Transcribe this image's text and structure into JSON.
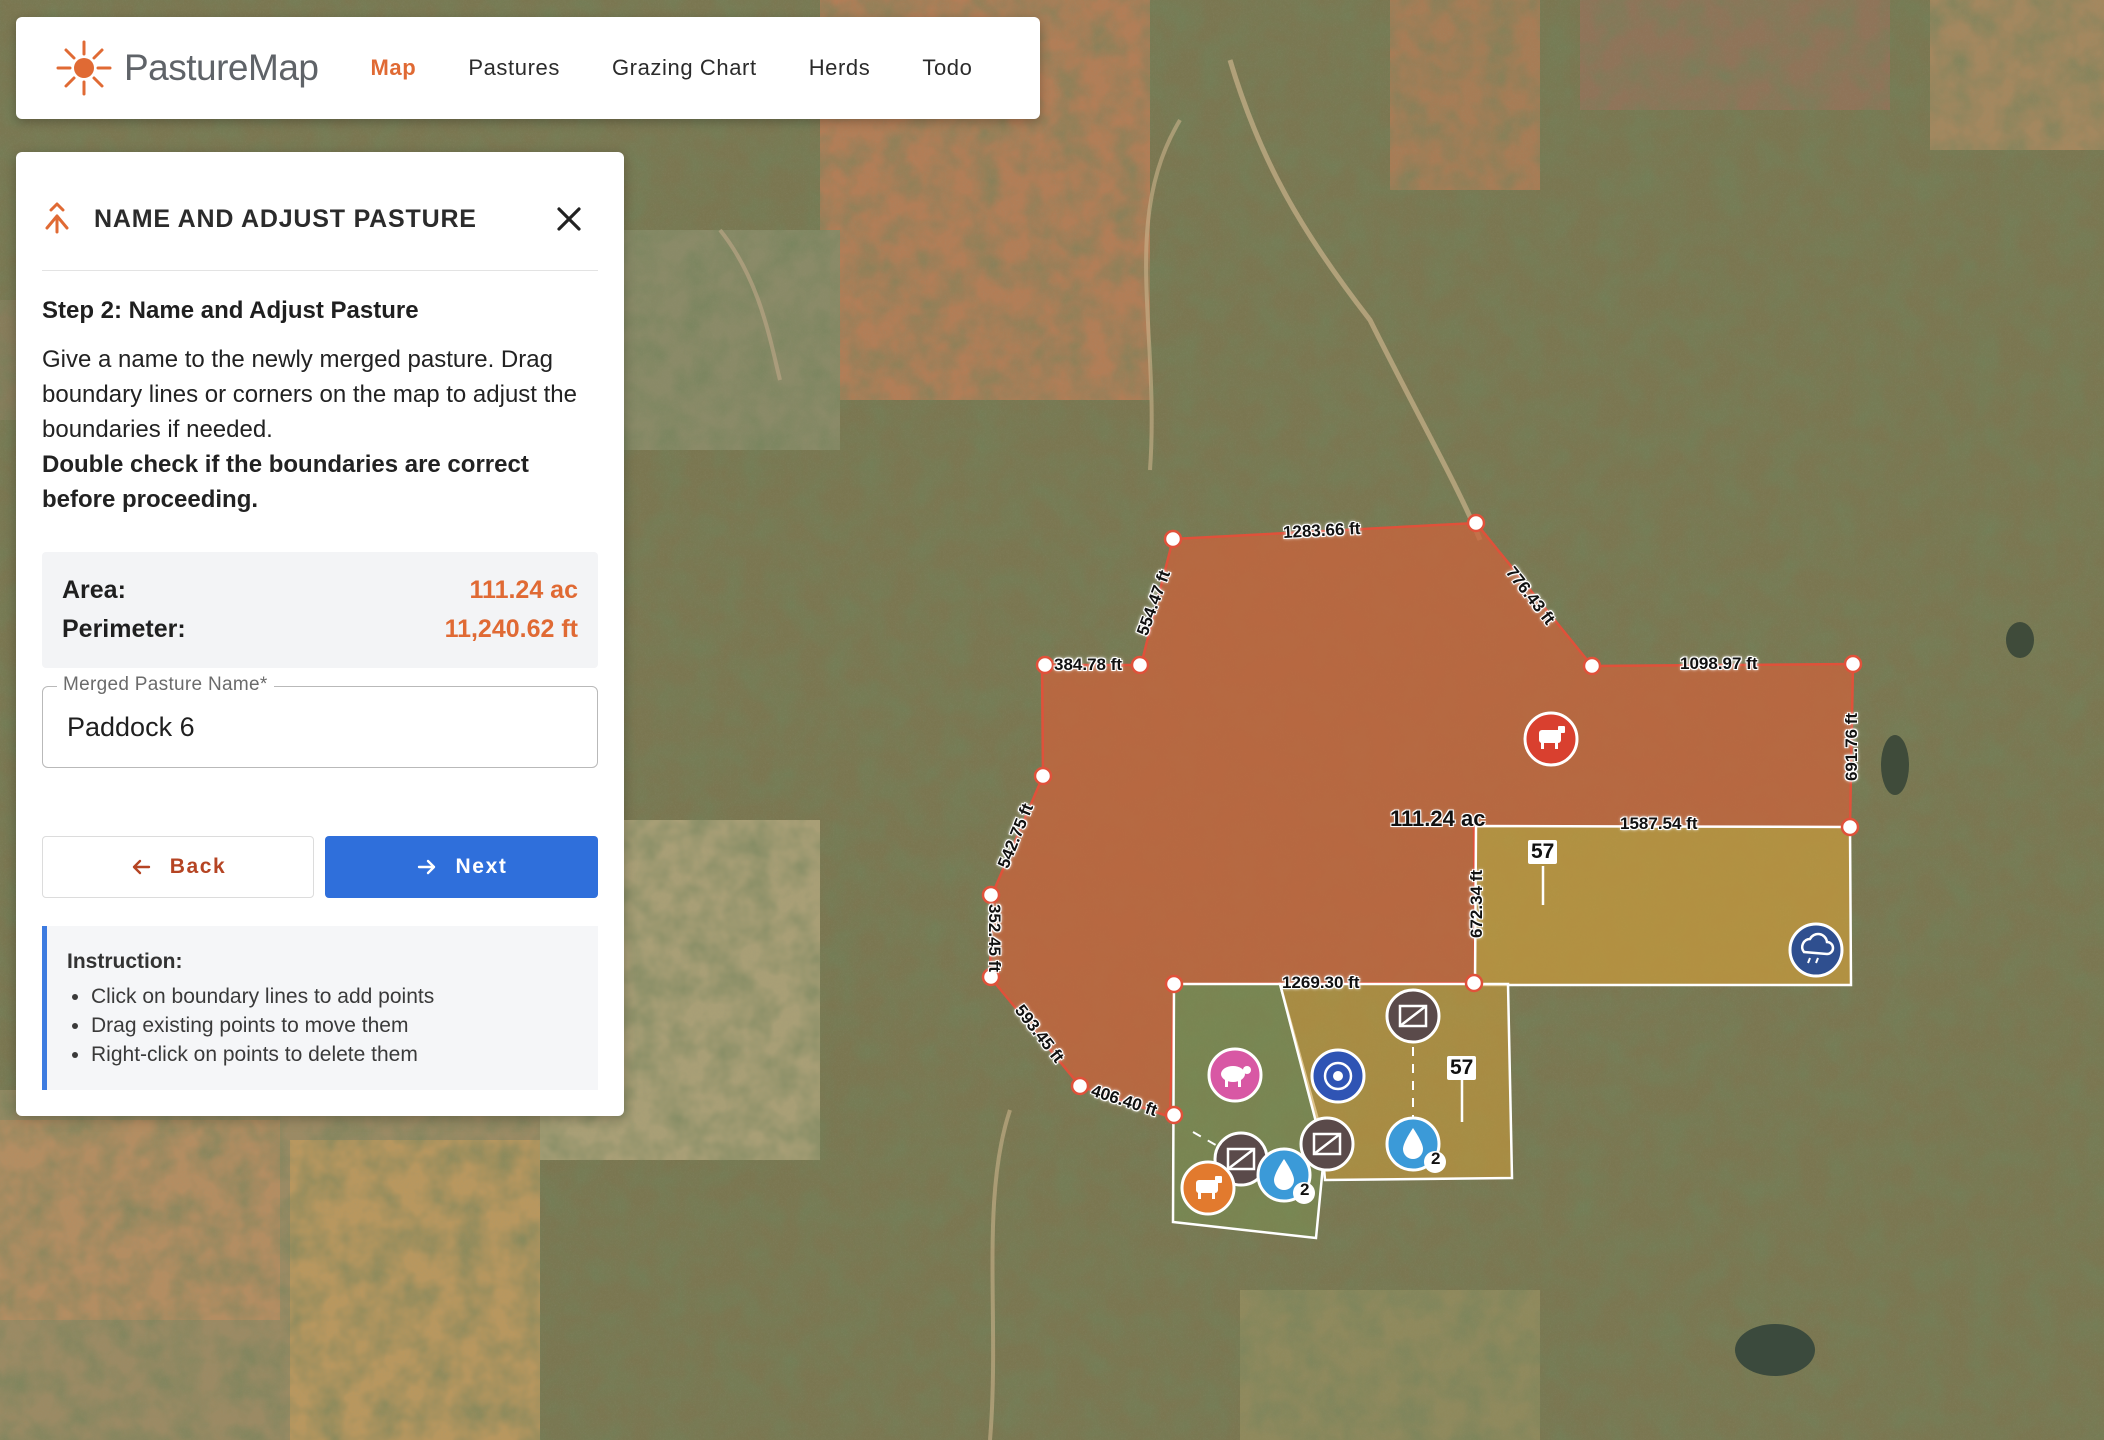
{
  "brand": {
    "name": "PastureMap",
    "accent": "#e06a34"
  },
  "nav": {
    "items": [
      {
        "label": "Map",
        "active": true
      },
      {
        "label": "Pastures",
        "active": false
      },
      {
        "label": "Grazing Chart",
        "active": false
      },
      {
        "label": "Herds",
        "active": false
      },
      {
        "label": "Todo",
        "active": false
      }
    ]
  },
  "panel": {
    "title": "NAME AND ADJUST PASTURE",
    "step_title": "Step 2: Name and Adjust Pasture",
    "description": "Give a name to the newly merged pasture. Drag boundary lines or corners on the map to adjust the boundaries if needed.",
    "warning": "Double check if the boundaries are correct before proceeding.",
    "area_label": "Area:",
    "area_value": "111.24 ac",
    "perimeter_label": "Perimeter:",
    "perimeter_value": "11,240.62 ft",
    "name_field_label": "Merged Pasture Name*",
    "name_field_value": "Paddock 6",
    "back_label": "Back",
    "next_label": "Next",
    "instruction_title": "Instruction:",
    "instructions": [
      "Click on boundary lines to add points",
      "Drag existing points to move them",
      "Right-click on points to delete them"
    ]
  },
  "map": {
    "merged_area": "111.24 ac",
    "edge_lengths": {
      "top": "1283.66 ft",
      "top_right_diag": "776.43 ft",
      "right_top": "1098.97 ft",
      "right_side": "691.76 ft",
      "inner_horizontal": "1587.54 ft",
      "inner_vertical": "672.34 ft",
      "bottom_inner": "1269.30 ft",
      "left_notch_vertical": "554.47 ft",
      "left_notch_horizontal": "384.78 ft",
      "left_upper": "542.75 ft",
      "left_lower": "352.45 ft",
      "bottom_left_diag": "593.45 ft",
      "bottom_left": "406.40 ft"
    },
    "pasture_counts": [
      "57",
      "57"
    ],
    "badge_counts": [
      "2",
      "2"
    ],
    "icons": [
      "cow-icon",
      "cloud-rain-icon",
      "sheep-icon",
      "target-icon",
      "gate-icon",
      "water-drop-icon"
    ]
  }
}
